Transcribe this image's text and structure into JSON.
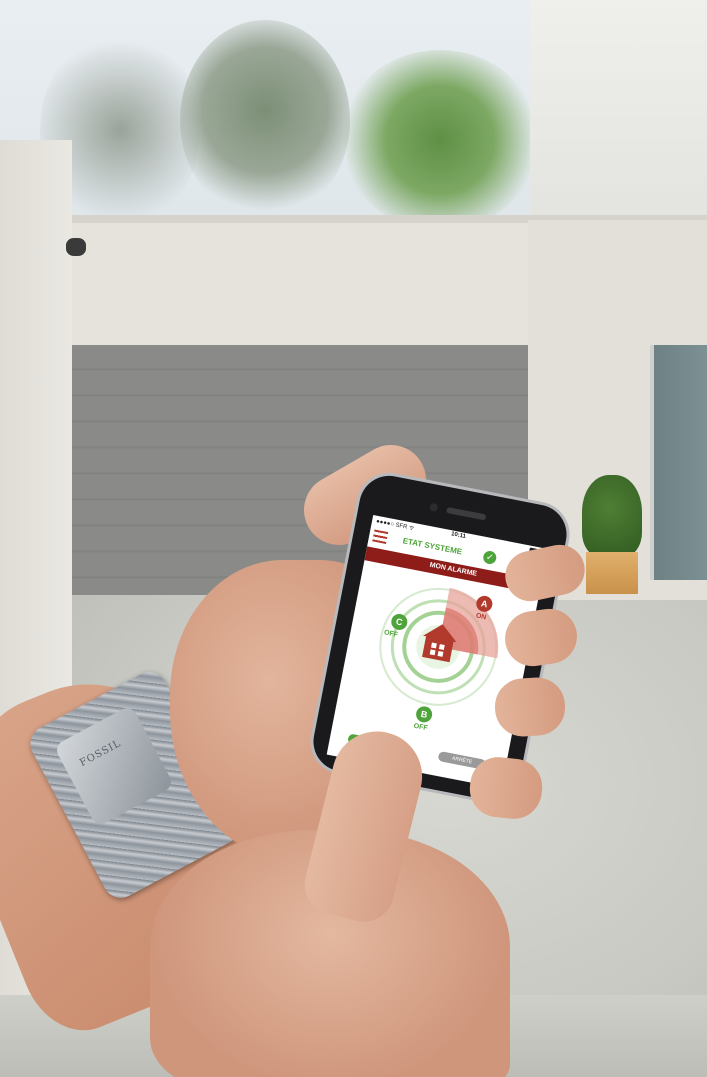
{
  "scene": {
    "description_tag": "",
    "watch_brand": "FOSSIL"
  },
  "app": {
    "status_carrier": "●●●●○ SFR ᯤ",
    "status_time": "10:11",
    "title": "ETAT SYSTEME",
    "banner": "MON ALARME",
    "zones": [
      {
        "letter": "A",
        "state": "ON",
        "color": "#b13a2d"
      },
      {
        "letter": "B",
        "state": "OFF",
        "color": "#4ea43a"
      },
      {
        "letter": "C",
        "state": "OFF",
        "color": "#4ea43a"
      }
    ],
    "button_on_label": "",
    "button_off_label": "ARRÊTÉ"
  },
  "colors": {
    "green": "#4ea43a",
    "red": "#b13a2d",
    "dark_red": "#8e1d1a"
  },
  "icons": {
    "menu": "menu-icon",
    "check": "check-icon",
    "eye": "eye-icon",
    "house": "house-icon"
  }
}
